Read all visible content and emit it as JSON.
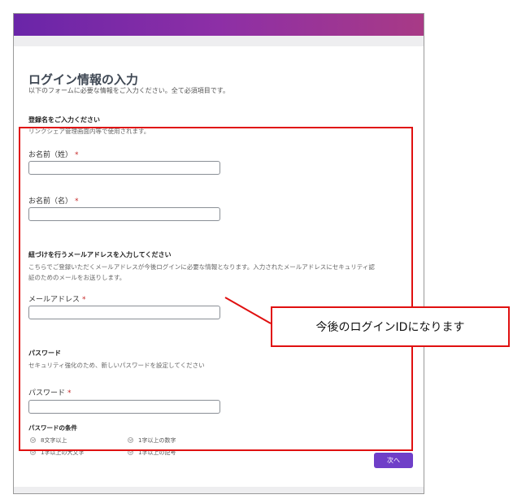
{
  "form": {
    "title": "ログイン情報の入力",
    "subtitle": "以下のフォームに必要な情報をご入力ください。全て必須項目です。",
    "name_section": {
      "heading": "登録名をご入力ください",
      "description": "リンクシェア管理画面内等で使用されます。"
    },
    "last_name": {
      "label": "お名前（姓）",
      "required_mark": "*",
      "value": ""
    },
    "first_name": {
      "label": "お名前（名）",
      "required_mark": "*",
      "value": ""
    },
    "email_section": {
      "heading": "紐づけを行うメールアドレスを入力してください",
      "description_line1": "こちらでご登録いただくメールアドレスが今後ログインに必要な情報となります。入力されたメールアドレスにセキュリティ認",
      "description_line2": "証のためのメールをお送りします。"
    },
    "email": {
      "label": "メールアドレス",
      "required_mark": "*",
      "value": ""
    },
    "password_section": {
      "heading": "パスワード",
      "description": "セキュリティ強化のため、新しいパスワードを設定してください"
    },
    "password": {
      "label": "パスワード",
      "required_mark": "*",
      "value": ""
    },
    "password_conditions": {
      "heading": "パスワードの条件",
      "items": [
        "8文字以上",
        "1字以上の数字",
        "1字以上の大文字",
        "1字以上の記号"
      ]
    },
    "next_button": "次へ"
  },
  "annotation": {
    "callout_text": "今後のログインIDになります",
    "color": "#e01010"
  },
  "colors": {
    "header_gradient_start": "#6a25a8",
    "header_gradient_end": "#a83a86",
    "button": "#6f3fc8",
    "required": "#c62828"
  }
}
